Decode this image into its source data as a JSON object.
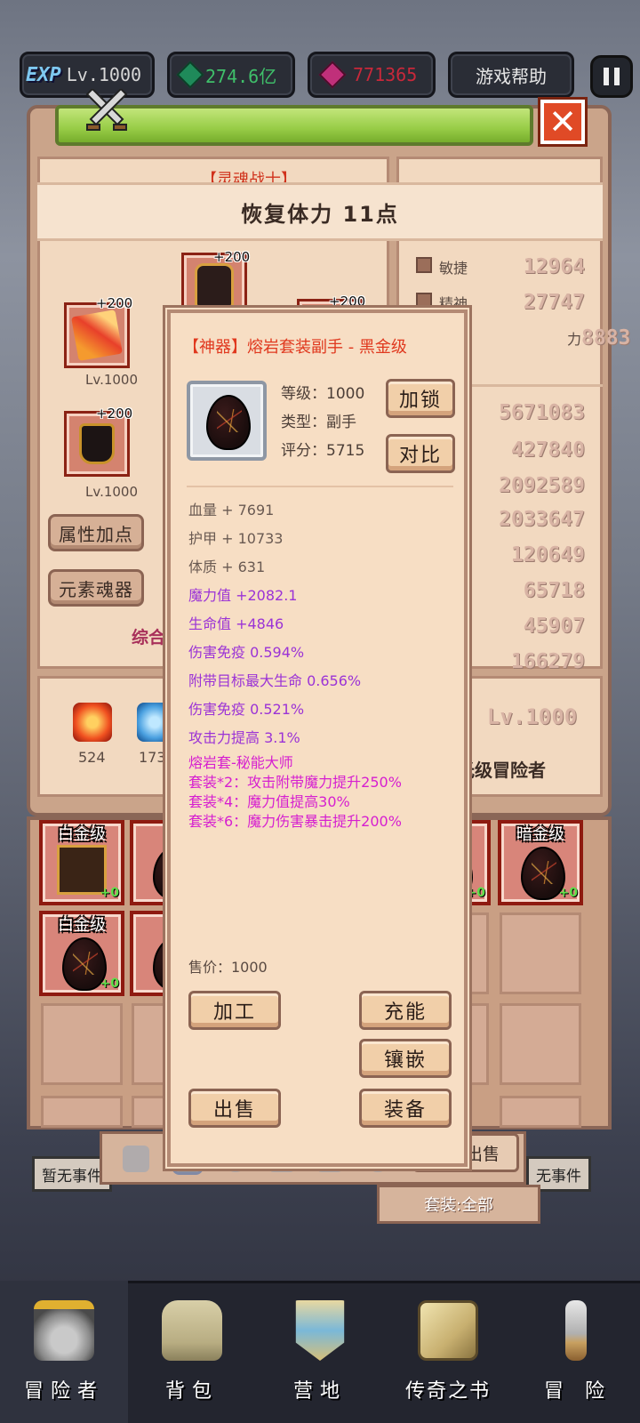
{
  "hud": {
    "exp_badge": "EXP",
    "level": "Lv.1000",
    "gems": "274.6亿",
    "rubies": "771365",
    "help_label": "游戏帮助"
  },
  "panel": {
    "title": "【灵魂战士】",
    "restore_text": "恢复体力 11点",
    "close_label": "✕",
    "equip": [
      {
        "plus": "+200",
        "lv": "Lv.1000"
      },
      {
        "plus": "+200",
        "lv": "Lv.1000"
      },
      {
        "plus": "+200"
      },
      {
        "plus": "+200"
      }
    ],
    "buttons": {
      "attr_points": "属性加点",
      "element_soul": "元素魂器",
      "summary": "综合"
    },
    "stats_top": [
      {
        "label": "敏捷",
        "value": "12964"
      },
      {
        "label": "精神",
        "value": "27747"
      },
      {
        "label": "力",
        "value": "8883"
      }
    ],
    "stats_right": [
      "5671083",
      "427840",
      "2092589",
      "2033647",
      "120649",
      "65718",
      "45907",
      "166279"
    ],
    "resources": [
      {
        "value": "524"
      },
      {
        "value": "173"
      }
    ],
    "player_level": "Lv.1000",
    "player_rank": "光级冒险者"
  },
  "inventory": {
    "items": [
      {
        "rarity": "白金级",
        "plus": "+0"
      },
      {
        "rarity": "白",
        "plus": ""
      },
      {
        "rarity": "级",
        "plus": "+0"
      },
      {
        "rarity": "暗金级",
        "plus": "+0"
      },
      {
        "rarity": "白金级",
        "plus": "+0"
      },
      {
        "rarity": "黑",
        "plus": ""
      }
    ],
    "batch_sell": "批量出售",
    "set_filter": "套装:全部",
    "no_event_left": "暂无事件",
    "no_event_right": "无事件"
  },
  "popup": {
    "title": "【神器】熔岩套装副手 - 黑金级",
    "level_line": "等级：1000",
    "type_line": "类型：副手",
    "score_line": "评分：5715",
    "lock_label": "加锁",
    "compare_label": "对比",
    "attributes": [
      {
        "text": "血量 + 7691",
        "kind": "base"
      },
      {
        "text": "护甲 + 10733",
        "kind": "base"
      },
      {
        "text": "体质 + 631",
        "kind": "base"
      },
      {
        "text": "魔力值 +2082.1",
        "kind": "magic"
      },
      {
        "text": "生命值 +4846",
        "kind": "magic"
      },
      {
        "text": "伤害免疫 0.594%",
        "kind": "magic"
      },
      {
        "text": "附带目标最大生命 0.656%",
        "kind": "magic"
      },
      {
        "text": "伤害免疫 0.521%",
        "kind": "magic"
      },
      {
        "text": "攻击力提高 3.1%",
        "kind": "magic"
      }
    ],
    "set_name": "熔岩套-秘能大师",
    "set_bonuses": [
      "套装*2：攻击附带魔力提升250%",
      "套装*4：魔力值提高30%",
      "套装*6：魔力伤害暴击提升200%"
    ],
    "sell_price": "售价：1000",
    "buttons": {
      "craft": "加工",
      "charge": "充能",
      "inlay": "镶嵌",
      "sell": "出售",
      "equip": "装备"
    }
  },
  "nav": [
    {
      "label": "冒险者"
    },
    {
      "label": "背包"
    },
    {
      "label": "营地"
    },
    {
      "label": "传奇之书"
    },
    {
      "label": "冒险"
    }
  ]
}
